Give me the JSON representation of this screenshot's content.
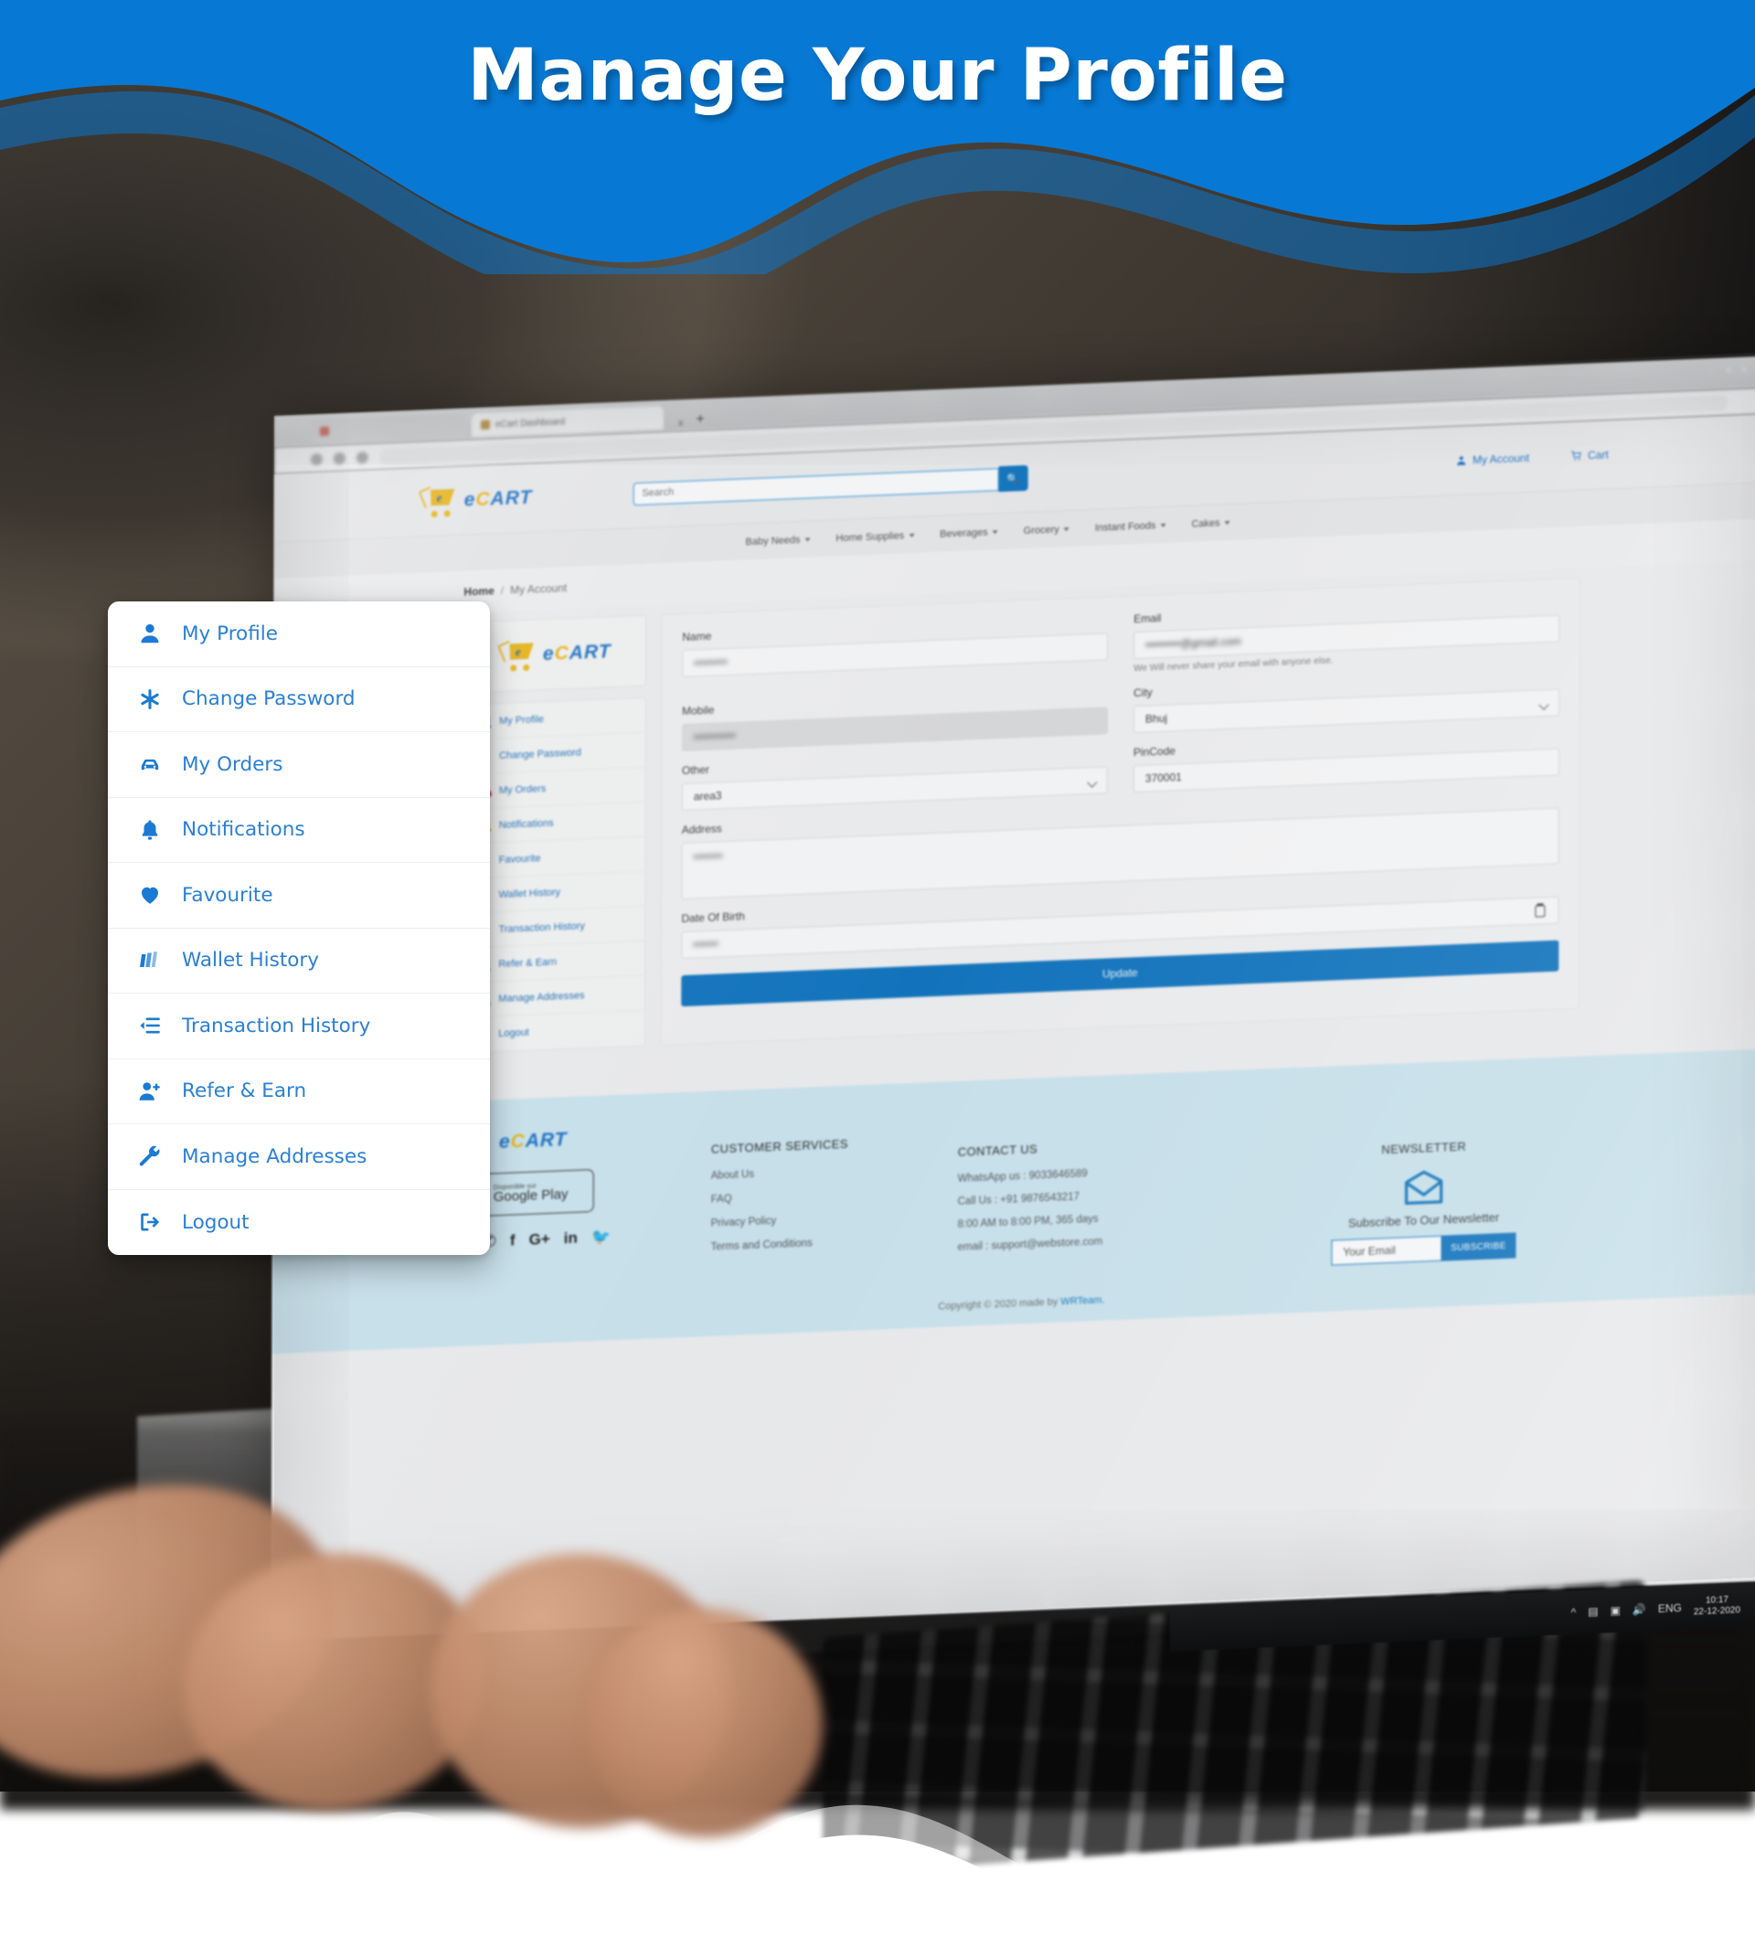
{
  "banner": {
    "title": "Manage Your Profile",
    "bg_color": "#0779d5"
  },
  "menu_card": {
    "items": [
      {
        "label": "My Profile",
        "icon": "user-icon"
      },
      {
        "label": "Change Password",
        "icon": "asterisk-icon"
      },
      {
        "label": "My Orders",
        "icon": "car-icon"
      },
      {
        "label": "Notifications",
        "icon": "bell-icon"
      },
      {
        "label": "Favourite",
        "icon": "heart-icon"
      },
      {
        "label": "Wallet History",
        "icon": "wallet-icon"
      },
      {
        "label": "Transaction History",
        "icon": "list-indent-icon"
      },
      {
        "label": "Refer & Earn",
        "icon": "user-plus-icon"
      },
      {
        "label": "Manage Addresses",
        "icon": "wrench-icon"
      },
      {
        "label": "Logout",
        "icon": "sign-out-icon"
      }
    ],
    "accent_color": "#1a7ad4"
  },
  "browser": {
    "tabs": [
      {
        "label": "",
        "active": false
      },
      {
        "label": "eCart  Dashboard",
        "active": true
      }
    ],
    "close_label": "x",
    "new_tab_label": "+",
    "url": ""
  },
  "site": {
    "brand": {
      "e": "e",
      "c": "C",
      "art": "ART",
      "full": "eCART"
    },
    "search": {
      "placeholder": "Search",
      "value": "",
      "button_icon": "search-icon"
    },
    "account_label": "My Account",
    "cart_label": "Cart",
    "nav": [
      "Baby Needs",
      "Home Supplies",
      "Beverages",
      "Grocery",
      "Instant Foods",
      "Cakes"
    ],
    "breadcrumb": {
      "home": "Home",
      "separator": "/",
      "current": "My Account"
    },
    "sidebar_items": [
      "My Profile",
      "Change Password",
      "My Orders",
      "Notifications",
      "Favourite",
      "Wallet History",
      "Transaction History",
      "Refer & Earn",
      "Manage Addresses",
      "Logout"
    ],
    "form": {
      "name": {
        "label": "Name",
        "value": "••••••••"
      },
      "email": {
        "label": "Email",
        "value": "•••••••••@gmail.com",
        "help": "We Will never share your email with anyone else."
      },
      "mobile": {
        "label": "Mobile",
        "value": "••••••••••"
      },
      "city": {
        "label": "City",
        "value": "Bhuj"
      },
      "other": {
        "label": "Other",
        "value": "area3"
      },
      "pincode": {
        "label": "PinCode",
        "value": "370001"
      },
      "address": {
        "label": "Address",
        "value": "•••••••"
      },
      "dob": {
        "label": "Date Of Birth",
        "value": "••••••"
      },
      "update_button": "Update"
    },
    "footer": {
      "google_play": {
        "sub": "Disponible sur",
        "main": "Google Play"
      },
      "socials": [
        "instagram-icon",
        "whatsapp-icon",
        "facebook-icon",
        "google-plus-icon",
        "linkedin-icon",
        "twitter-icon"
      ],
      "customer_services": {
        "heading": "CUSTOMER SERVICES",
        "links": [
          "About Us",
          "FAQ",
          "Privacy Policy",
          "Terms and Conditions"
        ]
      },
      "contact": {
        "heading": "CONTACT US",
        "lines": [
          "WhatsApp us : 9033646589",
          "Call Us : +91 9876543217",
          "8:00 AM to 8:00 PM, 365 days",
          "email : support@webstore.com"
        ]
      },
      "newsletter": {
        "heading": "NEWSLETTER",
        "subtitle": "Subscribe To Our Newsletter",
        "placeholder": "Your Email",
        "button": "SUBSCRIBE",
        "icon": "envelope-icon"
      },
      "copyright": {
        "text": "Copyright © 2020 made by ",
        "link": "WRTeam",
        "suffix": "."
      }
    }
  },
  "taskbar": {
    "language": "ENG",
    "time": "10:17",
    "date": "22-12-2020"
  }
}
